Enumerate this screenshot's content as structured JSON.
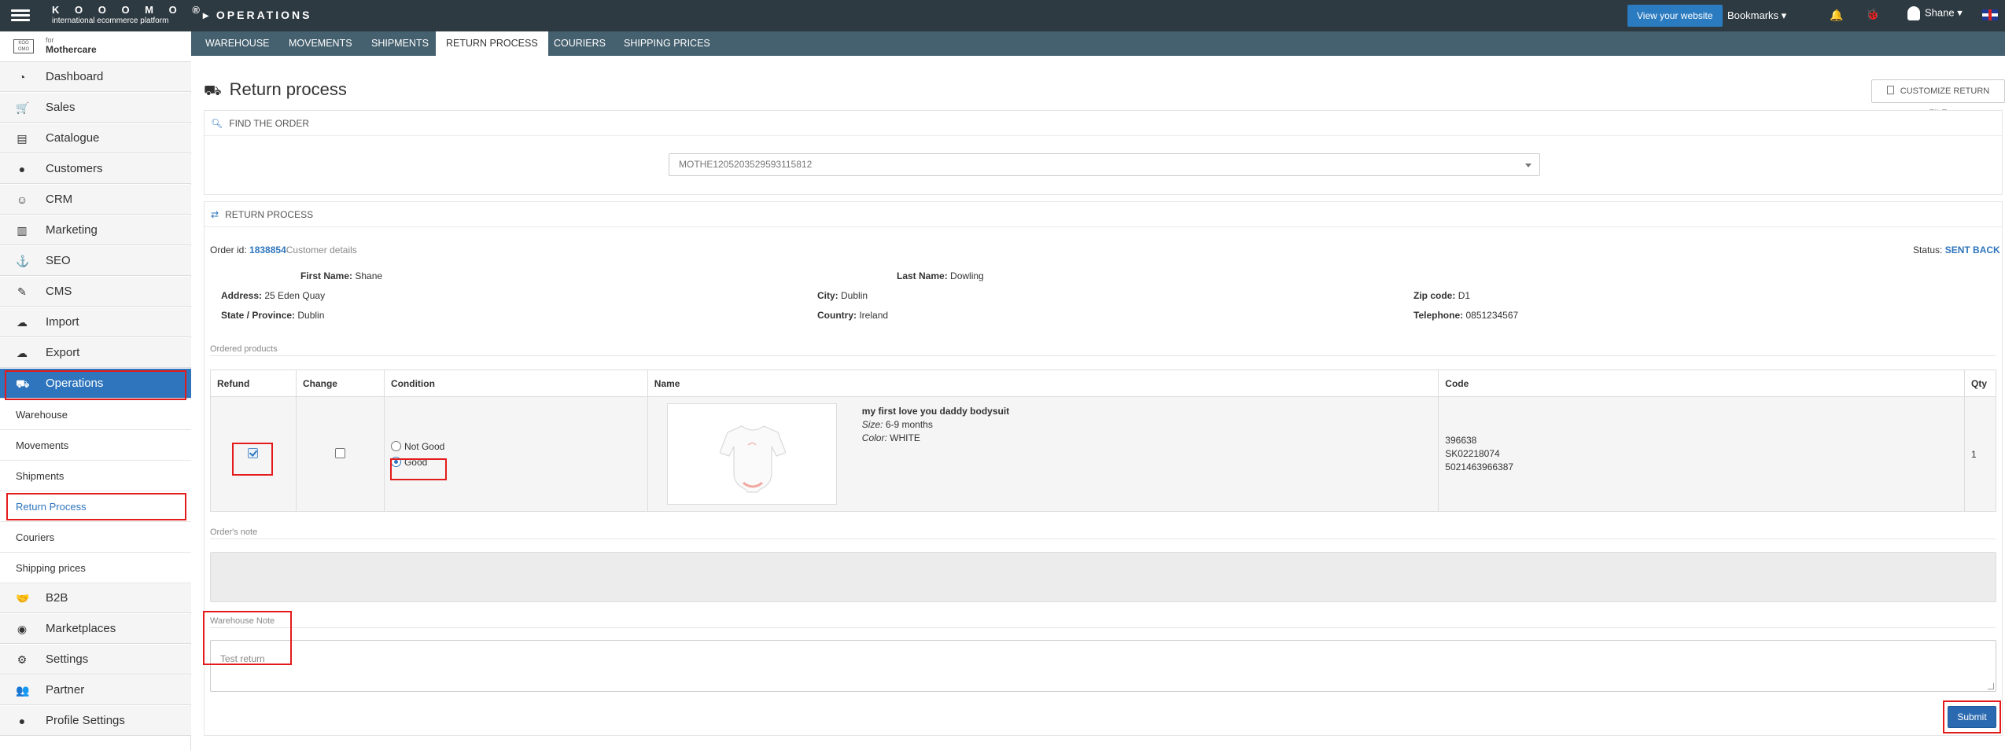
{
  "topbar": {
    "brand": "K O O O M O ®",
    "tagline": "international ecommerce platform",
    "section": "OPERATIONS",
    "view_website": "View your website",
    "bookmarks": "Bookmarks",
    "user": "Shane"
  },
  "store": {
    "for": "for",
    "name": "Mothercare"
  },
  "tabs": [
    "WAREHOUSE",
    "MOVEMENTS",
    "SHIPMENTS",
    "RETURN PROCESS",
    "COURIERS",
    "SHIPPING PRICES"
  ],
  "active_tab": "RETURN PROCESS",
  "sidebar": {
    "items": [
      {
        "label": "Dashboard",
        "icon": "dashboard-icon"
      },
      {
        "label": "Sales",
        "icon": "cart-icon"
      },
      {
        "label": "Catalogue",
        "icon": "archive-icon"
      },
      {
        "label": "Customers",
        "icon": "user-icon"
      },
      {
        "label": "CRM",
        "icon": "smile-icon"
      },
      {
        "label": "Marketing",
        "icon": "bar-chart-icon"
      },
      {
        "label": "SEO",
        "icon": "anchor-icon"
      },
      {
        "label": "CMS",
        "icon": "edit-icon"
      },
      {
        "label": "Import",
        "icon": "cloud-upload-icon"
      },
      {
        "label": "Export",
        "icon": "cloud-download-icon"
      },
      {
        "label": "Operations",
        "icon": "truck-icon"
      }
    ],
    "sub_items": [
      "Warehouse",
      "Movements",
      "Shipments",
      "Return Process",
      "Couriers",
      "Shipping prices"
    ],
    "items_after": [
      {
        "label": "B2B",
        "icon": "handshake-icon"
      },
      {
        "label": "Marketplaces",
        "icon": "globe-icon"
      },
      {
        "label": "Settings",
        "icon": "gear-icon"
      },
      {
        "label": "Partner",
        "icon": "users-icon"
      },
      {
        "label": "Profile Settings",
        "icon": "user-icon"
      }
    ]
  },
  "page": {
    "title": "Return process",
    "customize_button": "CUSTOMIZE RETURN FILE",
    "find_order_heading": "FIND THE ORDER",
    "order_select_value": "MOTHE1205203529593115812",
    "return_process_heading": "RETURN PROCESS"
  },
  "order": {
    "id_label": "Order id:",
    "id": "1838854",
    "customer_details": "Customer details",
    "status_label": "Status:",
    "status": "SENT BACK",
    "first_name_label": "First Name:",
    "first_name": "Shane",
    "last_name_label": "Last Name:",
    "last_name": "Dowling",
    "address_label": "Address:",
    "address": "25 Eden Quay",
    "city_label": "City:",
    "city": "Dublin",
    "zip_label": "Zip code:",
    "zip": "D1",
    "state_label": "State / Province:",
    "state": "Dublin",
    "country_label": "Country:",
    "country": "Ireland",
    "telephone_label": "Telephone:",
    "telephone": "0851234567"
  },
  "products": {
    "section_label": "Ordered products",
    "headers": {
      "refund": "Refund",
      "change": "Change",
      "condition": "Condition",
      "name": "Name",
      "code": "Code",
      "qty": "Qty"
    },
    "row": {
      "refund_checked": true,
      "change_checked": false,
      "condition_options": [
        "Not Good",
        "Good"
      ],
      "condition_selected": "Good",
      "product_name": "my first love you daddy bodysuit",
      "size_label": "Size:",
      "size": "6-9 months",
      "color_label": "Color:",
      "color": "WHITE",
      "codes": [
        "396638",
        "SK02218074",
        "5021463966387"
      ],
      "qty": "1"
    }
  },
  "notes": {
    "order_note_label": "Order's note",
    "warehouse_note_label": "Warehouse Note",
    "warehouse_note_placeholder": "Test return"
  },
  "submit_label": "Submit",
  "colors": {
    "accent": "#2e75bd",
    "topbar": "#2e3a42",
    "subnav": "#45606e",
    "highlight": "#e31b1b"
  }
}
